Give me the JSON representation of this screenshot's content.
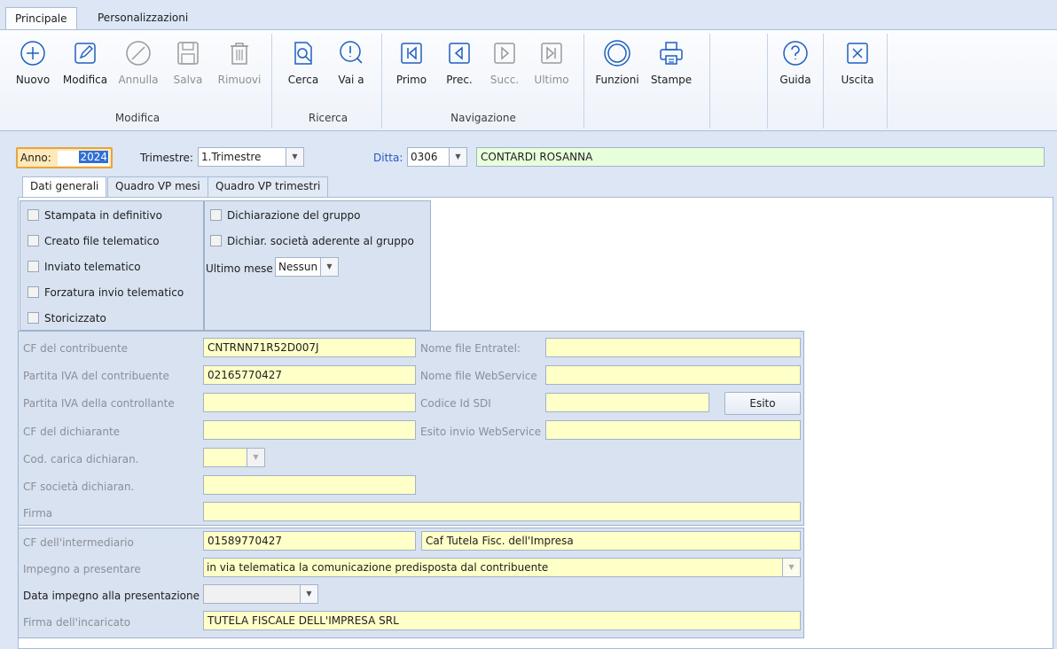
{
  "ribbon": {
    "tabs": [
      "Principale",
      "Personalizzazioni"
    ],
    "buttons": {
      "nuovo": "Nuovo",
      "modifica": "Modifica",
      "annulla": "Annulla",
      "salva": "Salva",
      "rimuovi": "Rimuovi",
      "cerca": "Cerca",
      "vai_a": "Vai a",
      "primo": "Primo",
      "prec": "Prec.",
      "succ": "Succ.",
      "ultimo": "Ultimo",
      "funzioni": "Funzioni",
      "stampe": "Stampe",
      "guida": "Guida",
      "uscita": "Uscita"
    },
    "groups": {
      "modifica": "Modifica",
      "ricerca": "Ricerca",
      "navigazione": "Navigazione"
    }
  },
  "header": {
    "anno_label": "Anno:",
    "anno_value": "2024",
    "trimestre_label": "Trimestre:",
    "trimestre_value": "1.Trimestre",
    "ditta_label": "Ditta:",
    "ditta_code": "0306",
    "ditta_name": "CONTARDI ROSANNA"
  },
  "form_tabs": [
    "Dati generali",
    "Quadro VP mesi",
    "Quadro VP trimestri"
  ],
  "flags": [
    "Stampata in definitivo",
    "Creato file telematico",
    "Inviato telematico",
    "Forzatura invio telematico",
    "Storicizzato"
  ],
  "group": {
    "dichiarazione": "Dichiarazione del gruppo",
    "aderente": "Dichiar. società aderente al gruppo",
    "ultimo_mese_label": "Ultimo mese",
    "ultimo_mese_value": "Nessun"
  },
  "contribuente": {
    "cf_label": "CF del contribuente",
    "cf_value": "CNTRNN71R52D007J",
    "piva_label": "Partita IVA del contribuente",
    "piva_value": "02165770427",
    "piva_ctrl_label": "Partita IVA della controllante",
    "piva_ctrl_value": "",
    "cf_dich_label": "CF del dichiarante",
    "cf_dich_value": "",
    "cod_carica_label": "Cod. carica dichiaran.",
    "cod_carica_value": "",
    "cf_soc_label": "CF società dichiaran.",
    "cf_soc_value": "",
    "firma_label": "Firma",
    "firma_value": "",
    "nome_entratel_label": "Nome file Entratel:",
    "nome_entratel_value": "",
    "nome_ws_label": "Nome file WebService",
    "nome_ws_value": "",
    "codice_sdi_label": "Codice Id SDI",
    "codice_sdi_value": "",
    "esito_button": "Esito",
    "esito_ws_label": "Esito invio WebService",
    "esito_ws_value": ""
  },
  "intermediario": {
    "cf_label": "CF dell'intermediario",
    "cf_value": "01589770427",
    "nome_value": "Caf Tutela Fisc. dell'Impresa",
    "impegno_label": "Impegno a presentare",
    "impegno_value": "in via telematica la comunicazione predisposta dal contribuente",
    "data_label": "Data impegno alla presentazione",
    "data_value": "",
    "firma_label": "Firma dell'incaricato",
    "firma_value": "TUTELA FISCALE DELL'IMPRESA SRL"
  },
  "colors": {
    "accent": "#2f6fd6",
    "field_yellow": "#ffffc8",
    "field_green": "#e8ffdc",
    "panel": "#d8e2f1"
  }
}
